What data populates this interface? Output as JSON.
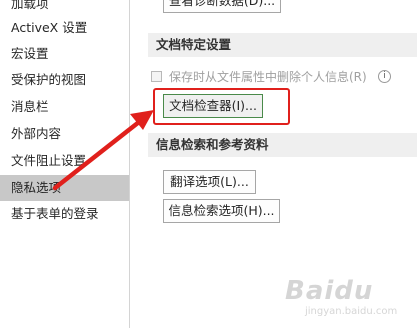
{
  "sidebar": {
    "items": [
      {
        "label": "加载项"
      },
      {
        "label": "ActiveX 设置"
      },
      {
        "label": "宏设置"
      },
      {
        "label": "受保护的视图"
      },
      {
        "label": "消息栏"
      },
      {
        "label": "外部内容"
      },
      {
        "label": "文件阻止设置"
      },
      {
        "label": "隐私选项",
        "active": true
      },
      {
        "label": "基于表单的登录"
      }
    ]
  },
  "main": {
    "top_button_label": "查看诊断数据(D)...",
    "doc_section": {
      "title": "文档特定设置",
      "checkbox_label": "保存时从文件属性中删除个人信息(R)",
      "checkbox_checked": false,
      "help_glyph": "i",
      "inspect_button_label": "文档检查器(I)..."
    },
    "research_section": {
      "title": "信息检索和参考资料",
      "translate_button_label": "翻译选项(L)...",
      "research_button_label": "信息检索选项(H)..."
    }
  },
  "annotation": {
    "arrow_color": "#e0201c",
    "highlight_color": "#e0201c"
  },
  "watermark": {
    "logo": "Baidu",
    "sub": "jingyan.baidu.com"
  }
}
